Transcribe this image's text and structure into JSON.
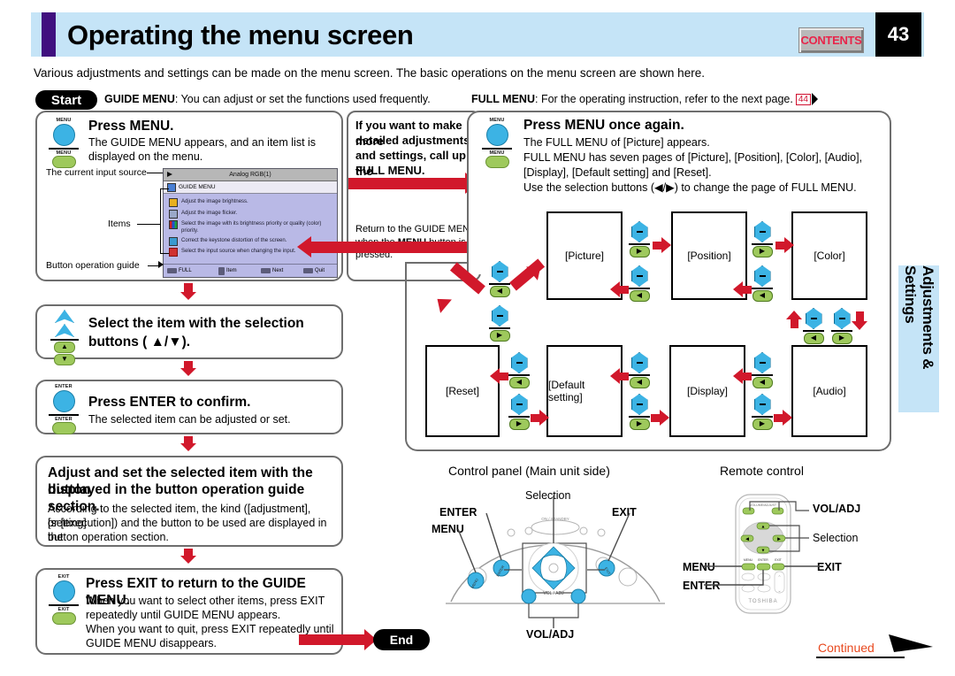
{
  "header": {
    "title": "Operating the menu screen",
    "contents_label": "CONTENTS",
    "page_number": "43"
  },
  "intro": "Various adjustments and settings can be made on the menu screen. The basic operations on the menu screen are shown here.",
  "start": {
    "badge": "Start",
    "guide_prefix": "GUIDE MENU",
    "guide_text": ": You can adjust or set the functions used frequently."
  },
  "full": {
    "prefix": "FULL MENU",
    "text": ": For the operating instruction, refer to the next page.",
    "page_ref": "44"
  },
  "left_steps": [
    {
      "button": "MENU",
      "title": "Press MENU.",
      "body_line1": "The GUIDE MENU appears, and an item list is",
      "body_line2": "displayed on the menu."
    },
    {
      "title_line1": "Select the item with the selection",
      "title_line2": "buttons ( ▲/▼)."
    },
    {
      "button": "ENTER",
      "title": "Press ENTER to confirm.",
      "body_line1": "The selected item can be adjusted or set."
    },
    {
      "title_line1": "Adjust and set the selected item with the button",
      "title_line2": "displayed in the button operation guide section.",
      "body_line1": "According to the selected item, the kind ([adjustment], [setting]",
      "body_line2": "or [execution]) and the button to be used are displayed in the",
      "body_line3": "button operation section."
    },
    {
      "button": "EXIT",
      "title": "Press EXIT to return to the GUIDE MENU.",
      "body_line1": "When you want to select other items, press EXIT",
      "body_line2": "repeatedly until GUIDE MENU appears.",
      "body_line3": "When you want to quit, press EXIT repeatedly until",
      "body_line4": "GUIDE MENU disappears."
    }
  ],
  "osd": {
    "callout_source": "The current input source",
    "callout_items": "Items",
    "callout_guide": "Button operation guide",
    "input_source": "Analog RGB(1)",
    "menu_title": "GUIDE MENU",
    "items": [
      "Adjust the image brightness.",
      "Adjust the image flicker.",
      "Select the image with its brightness priority or quality (color) priority.",
      "Correct the keystone distortion of the screen.",
      "Select the input source when changing the input."
    ],
    "guide_buttons": [
      "FULL",
      "Item",
      "Next",
      "Quit"
    ]
  },
  "middle": {
    "title_line1": "If you want to make more",
    "title_line2": "detailed adjustments",
    "title_line3": "and settings, call up the",
    "title_line4": "FULL MENU.",
    "note_line1": "Return to the GUIDE MENU",
    "note_line2_a": "when the ",
    "note_line2_b": "MENU",
    "note_line2_c": " button is pressed."
  },
  "right_step": {
    "button": "MENU",
    "title": "Press MENU once again.",
    "body_line1": "The FULL MENU of [Picture] appears.",
    "body_line2": "FULL MENU has seven pages of [Picture], [Position], [Color], [Audio],",
    "body_line3": "[Display], [Default setting] and [Reset].",
    "body_line4": "Use the selection buttons (◀/▶) to change the page of FULL MENU."
  },
  "full_menu_pages": {
    "top_row": [
      "[Picture]",
      "[Position]",
      "[Color]"
    ],
    "bottom_row": [
      "[Reset]",
      "[Default setting]",
      "[Display]",
      "[Audio]"
    ]
  },
  "sidebar_tab": "Adjustments & Settings",
  "control_panel": {
    "title": "Control panel (Main unit side)",
    "label_selection": "Selection",
    "label_enter": "ENTER",
    "label_exit": "EXIT",
    "label_menu": "MENU",
    "label_voladj": "VOL/ADJ"
  },
  "remote": {
    "title": "Remote control",
    "label_voladj": "VOL/ADJ",
    "label_selection": "Selection",
    "label_menu": "MENU",
    "label_enter": "ENTER",
    "label_exit": "EXIT",
    "brand": "TOSHIBA",
    "top_caption": "VOLUME/ADJUST"
  },
  "end_badge": "End",
  "continued": "Continued",
  "colors": {
    "header_band": "#c5e4f7",
    "header_bar": "#40107f",
    "accent_red": "#d1182b",
    "contents_red": "#e8254a",
    "button_blue": "#3cb3e4",
    "button_green": "#9ec95c",
    "osd_panel": "#b9b9e6",
    "continued": "#e8491f"
  }
}
